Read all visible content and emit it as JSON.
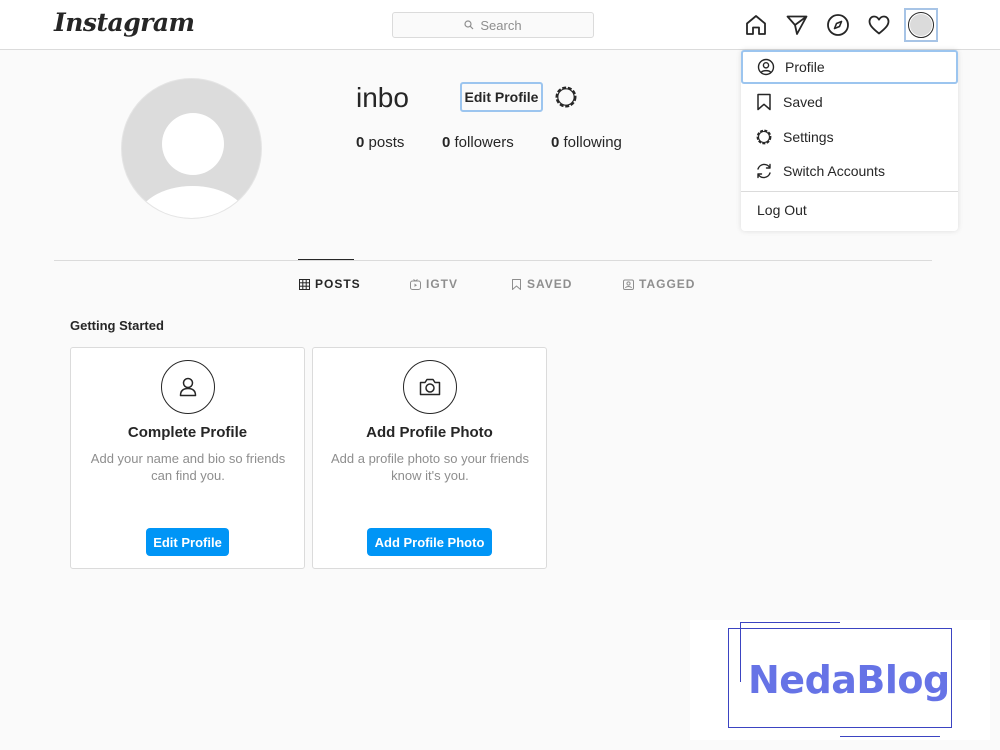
{
  "app": {
    "logo": "Instagram"
  },
  "search": {
    "placeholder": "Search"
  },
  "nav": {
    "icons": [
      "home-icon",
      "direct-message-icon",
      "explore-compass-icon",
      "activity-heart-icon",
      "profile-avatar"
    ]
  },
  "profile": {
    "username": "inbo",
    "edit_label": "Edit Profile",
    "stats": [
      {
        "count": "0",
        "label": "posts"
      },
      {
        "count": "0",
        "label": "followers"
      },
      {
        "count": "0",
        "label": "following"
      }
    ]
  },
  "tabs": [
    {
      "label": "POSTS",
      "icon": "grid-icon",
      "active": true
    },
    {
      "label": "IGTV",
      "icon": "igtv-icon",
      "active": false
    },
    {
      "label": "SAVED",
      "icon": "bookmark-icon",
      "active": false
    },
    {
      "label": "TAGGED",
      "icon": "tag-icon",
      "active": false
    }
  ],
  "getting_started": {
    "title": "Getting Started",
    "cards": [
      {
        "title": "Complete Profile",
        "description": "Add your name and bio so friends can find you.",
        "button": "Edit Profile",
        "icon": "user-icon"
      },
      {
        "title": "Add Profile Photo",
        "description": "Add a profile photo so your friends know it's you.",
        "button": "Add Profile Photo",
        "icon": "camera-icon"
      }
    ]
  },
  "dropdown": {
    "items": [
      {
        "label": "Profile",
        "icon": "profile-circle-icon"
      },
      {
        "label": "Saved",
        "icon": "bookmark-icon"
      },
      {
        "label": "Settings",
        "icon": "settings-gear-icon"
      },
      {
        "label": "Switch Accounts",
        "icon": "switch-arrows-icon"
      }
    ],
    "logout": "Log Out"
  },
  "watermark": {
    "text": "NedaBlog"
  },
  "colors": {
    "accent": "#0095f6",
    "focus": "#9cc5ef",
    "border": "#dbdbdb",
    "text": "#262626",
    "muted": "#8e8e8e"
  }
}
